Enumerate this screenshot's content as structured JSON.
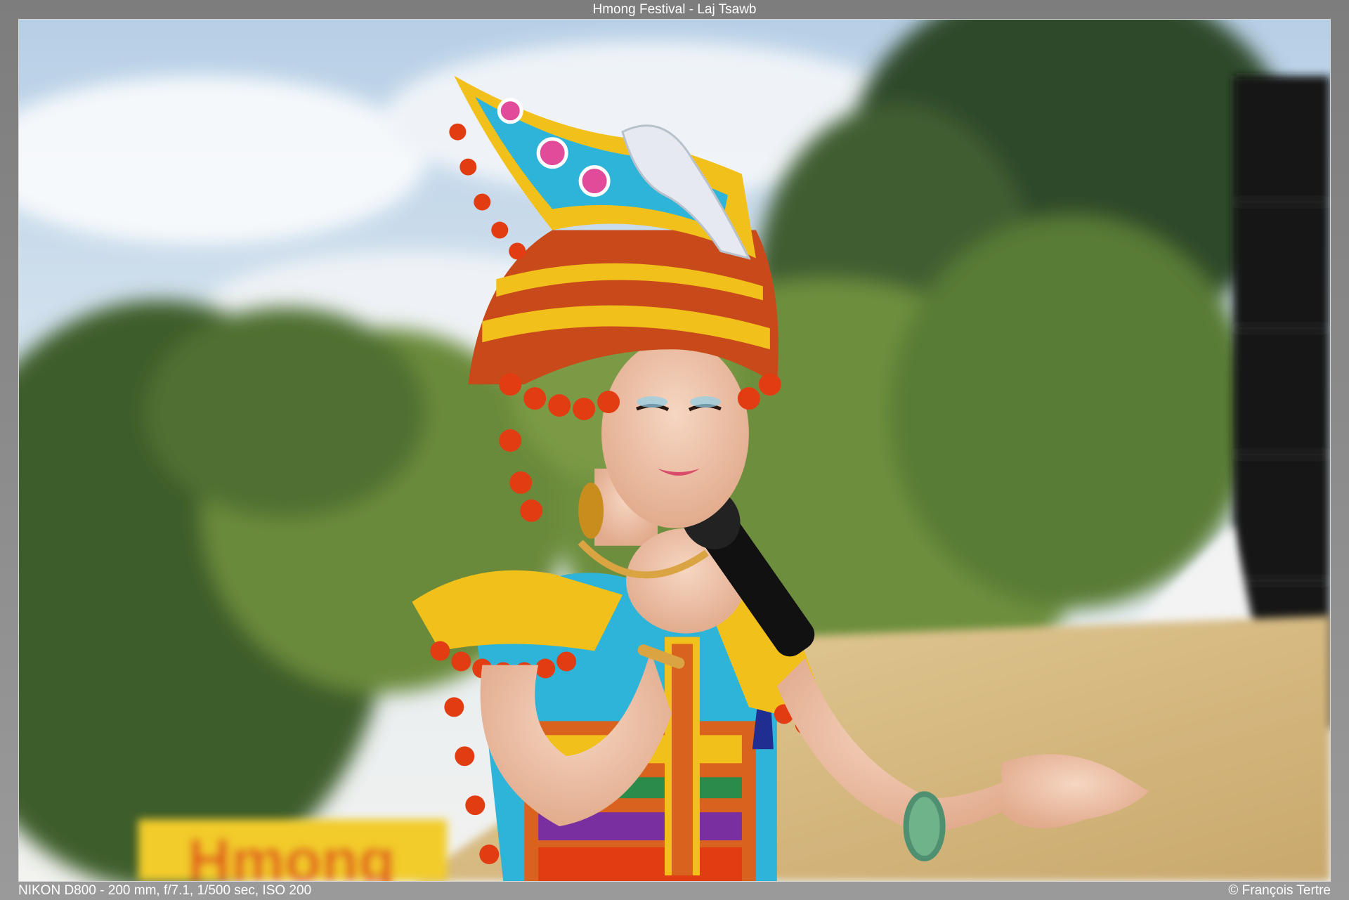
{
  "title": "Hmong Festival - Laj Tsawb",
  "exif": "NIKON D800 - 200 mm, f/7.1, 1/500 sec, ISO 200",
  "credit": "© François Tertre",
  "photo": {
    "sign_text": "Hmong"
  },
  "colors": {
    "sky": "#cfe0ee",
    "foliage": "#5f7f3a",
    "thatch": "#d9bf8a",
    "accent_red": "#e23c12",
    "accent_yellow": "#f2c01b",
    "accent_turquoise": "#2fb4d9"
  }
}
